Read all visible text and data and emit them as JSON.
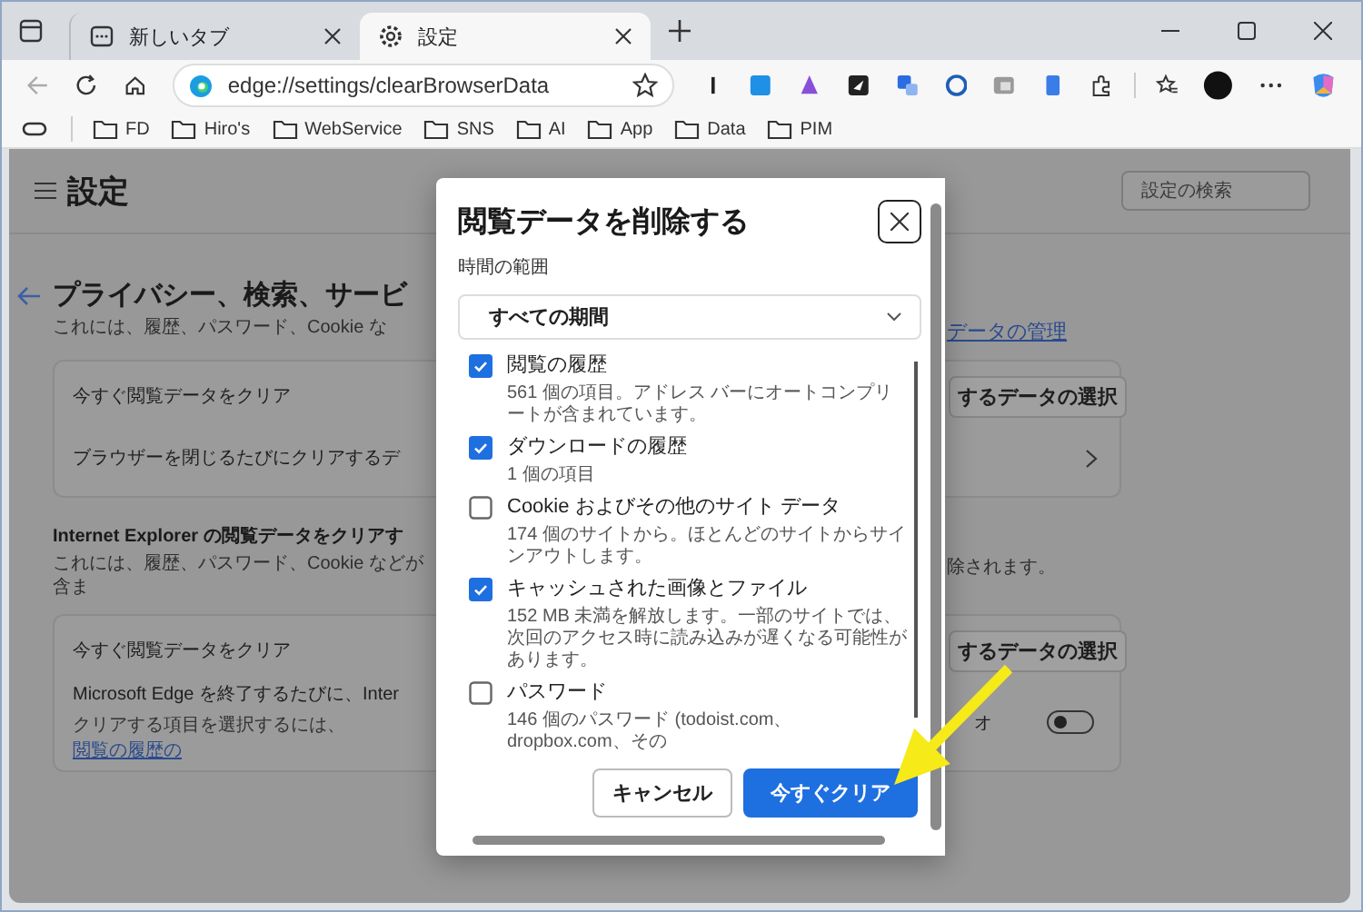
{
  "tabs": [
    {
      "label": "新しいタブ",
      "kind": "newtab",
      "selected": false
    },
    {
      "label": "設定",
      "kind": "settings",
      "selected": true
    }
  ],
  "address_bar": {
    "url": "edge://settings/clearBrowserData"
  },
  "favorites": [
    {
      "label": "FD"
    },
    {
      "label": "Hiro's"
    },
    {
      "label": "WebService"
    },
    {
      "label": "SNS"
    },
    {
      "label": "AI"
    },
    {
      "label": "App"
    },
    {
      "label": "Data"
    },
    {
      "label": "PIM"
    }
  ],
  "settings": {
    "title": "設定",
    "search": {
      "placeholder": "設定の検索"
    },
    "sections": [
      {
        "kind": "page",
        "heading": "プライバシー、検索、サービ",
        "description": "これには、履歴、パスワード、Cookie な",
        "aside": {
          "kind": "link",
          "text": "データの管理"
        },
        "rows": [
          {
            "kind": "button",
            "label": "今すぐ閲覧データをクリア",
            "button": "するデータの選択"
          },
          {
            "kind": "chevron",
            "label": "ブラウザーを閉じるたびにクリアするデ"
          }
        ]
      },
      {
        "kind": "group",
        "heading": "Internet Explorer の閲覧データをクリアす",
        "description": "これには、履歴、パスワード、Cookie などが含ま",
        "aside": {
          "kind": "text",
          "text": "除されます。"
        },
        "rows": [
          {
            "kind": "button",
            "label": "今すぐ閲覧データをクリア",
            "button": "するデータの選択"
          },
          {
            "kind": "toggle",
            "label": "Microsoft Edge を終了するたびに、Inter",
            "note": "クリアする項目を選択するには、",
            "note_link": "閲覧の履歴の",
            "aside": "オ",
            "on": false
          }
        ]
      }
    ]
  },
  "dialog": {
    "title": "閲覧データを削除する",
    "range_label": "時間の範囲",
    "range": "すべての期間",
    "items": [
      {
        "label": "閲覧の履歴",
        "description": "561 個の項目。アドレス バーにオートコンプリートが含まれています。",
        "checked": true
      },
      {
        "label": "ダウンロードの履歴",
        "description": "1 個の項目",
        "checked": true
      },
      {
        "label": "Cookie およびその他のサイト データ",
        "description": "174 個のサイトから。ほとんどのサイトからサインアウトします。",
        "checked": false
      },
      {
        "label": "キャッシュされた画像とファイル",
        "description": "152 MB 未満を解放します。一部のサイトでは、次回のアクセス時に読み込みが遅くなる可能性があります。",
        "checked": true
      },
      {
        "label": "パスワード",
        "description": "146 個のパスワード (todoist.com、dropbox.com、その",
        "checked": false
      }
    ],
    "buttons": [
      {
        "label": "キャンセル",
        "kind": "secondary"
      },
      {
        "label": "今すぐクリア",
        "kind": "primary"
      }
    ]
  }
}
